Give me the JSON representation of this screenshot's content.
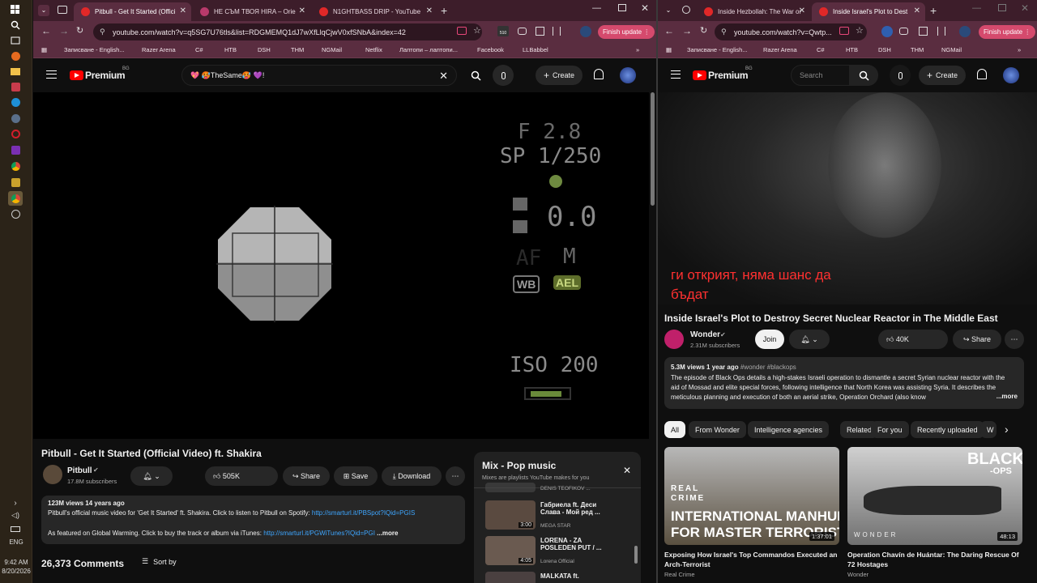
{
  "taskbar": {
    "time": "9:42 AM",
    "date": "8/20/2026",
    "lang": "ENG"
  },
  "left": {
    "tabs": [
      {
        "label": "Pitbull - Get It Started (Offici",
        "active": true
      },
      {
        "label": "НЕ СЪМ ТВОЯ HIRA – Orie",
        "active": false
      },
      {
        "label": "N1GHTBASS DRIP - YouTube",
        "active": false
      }
    ],
    "url": "youtube.com/watch?v=q5SG7U76tls&list=RDGMEMQ1dJ7wXfLlqCjwV0xfSNbA&index=42",
    "finish_update": "Finish update",
    "bookmarks": [
      "Записване - English...",
      "Razer Arena",
      "C#",
      "НТВ",
      "DSH",
      "THM",
      "NGMail",
      "Netflix",
      "Лаптопи – лаптопи...",
      "Facebook",
      "LLBabbel"
    ],
    "logo": "Premium",
    "logo_country": "BG",
    "search_value": "💖 🥵TheSame🥵 💜!",
    "create": "Create",
    "hud": {
      "f": "F 2.8",
      "sp": "SP 1/250",
      "ev": "0.0",
      "af": "AF",
      "m": "M",
      "wb": "WB",
      "ael": "AEL",
      "iso": "ISO 200"
    },
    "title": "Pitbull - Get It Started (Official Video) ft. Shakira",
    "channel": "Pitbull",
    "subs": "17.8M subscribers",
    "likes": "505K",
    "share": "Share",
    "save": "Save",
    "download": "Download",
    "views": "123M views  14 years ago",
    "desc1": "Pitbull's official music video for 'Get It Started' ft. Shakira. Click to listen to Pitbull on Spotify: ",
    "desc1_link": "http://smarturl.it/PBSpot?IQid=PGIS",
    "desc2": "As featured on Global Warming. Click to buy the track or album via iTunes: ",
    "desc2_link": "http://smarturl.it/PGWiTunes?IQid=PGI",
    "more": "...more",
    "comments": "26,373 Comments",
    "sort": "Sort by",
    "mix": {
      "title": "Mix - Pop music",
      "subtitle": "Mixes are playlists YouTube makes for you",
      "items": [
        {
          "title": "DENIS TEOFIKOV ...",
          "channel": "",
          "dur": ""
        },
        {
          "title": "Габриела ft. Деси Слава - Мой ред ...",
          "channel": "MEGA STAR",
          "dur": "3:00"
        },
        {
          "title": "LORENA - ZA POSLEDEN PUT / ...",
          "channel": "Lorena Official",
          "dur": "4:05"
        },
        {
          "title": "MALKATA ft.",
          "channel": "",
          "dur": ""
        }
      ]
    }
  },
  "right": {
    "tabs": [
      {
        "label": "Inside Hezbollah: The War or",
        "active": false
      },
      {
        "label": "Inside Israel's Plot to Dest",
        "active": true
      }
    ],
    "url": "youtube.com/watch?v=Qwtp...",
    "finish_update": "Finish update",
    "bookmarks": [
      "Записване - English...",
      "Razer Arena",
      "C#",
      "НТВ",
      "DSH",
      "THM",
      "NGMail"
    ],
    "logo": "Premium",
    "logo_country": "BG",
    "search_placeholder": "Search",
    "create": "Create",
    "subtitle1": "ги открият, няма шанс да",
    "subtitle2": "бъдат",
    "title": "Inside Israel's Plot to Destroy Secret Nuclear Reactor in The Middle East",
    "channel": "Wonder",
    "subs": "2.31M subscribers",
    "join": "Join",
    "likes": "40K",
    "share": "Share",
    "views": "5.3M views  1 year ago",
    "tags": "#wonder #blackops",
    "desc": "The episode of Black Ops details a high-stakes Israeli operation to dismantle a secret Syrian nuclear reactor with the aid of Mossad and elite special forces, following intelligence that North Korea was assisting Syria. It describes the meticulous planning and execution of both an aerial strike, Operation Orchard (also know",
    "more": "...more",
    "chips": [
      "All",
      "From Wonder",
      "Intelligence agencies",
      "Related",
      "For you",
      "Recently uploaded",
      "W"
    ],
    "videos": [
      {
        "title": "Exposing How Israel's Top Commandos Executed an Arch-Terrorist",
        "channel": "Real Crime",
        "dur": "1:37:01",
        "thumb1": "REAL",
        "thumb2": "CRIME",
        "thumb3": "INTERNATIONAL MANHUNT",
        "thumb4": "FOR MASTER TERRORIST"
      },
      {
        "title": "Operation Chavín de Huántar: The Daring Rescue Of 72 Hostages",
        "channel": "Wonder",
        "dur": "48:13",
        "thumb1": "BLACK",
        "thumb2": "-OPS",
        "thumb3": "WONDER"
      }
    ]
  },
  "colors": {
    "accent": "#ff0000",
    "chrome_tab": "#3d1d2a",
    "chrome_bar": "#5a2d40",
    "link": "#3ea6ff",
    "subtitle": "#ff3030"
  }
}
